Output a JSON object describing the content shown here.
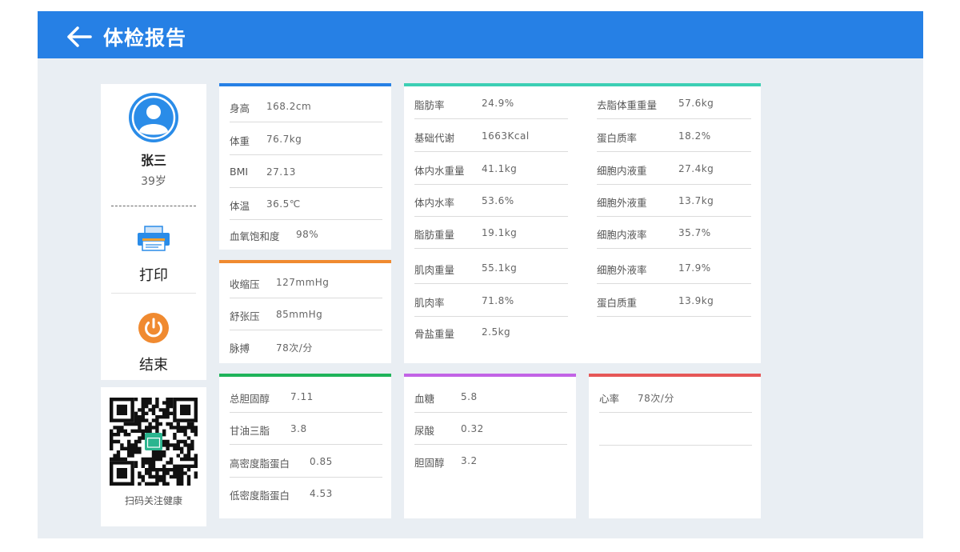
{
  "header": {
    "title": "体检报告"
  },
  "profile": {
    "name": "张三",
    "age": "39岁",
    "print_label": "打印",
    "end_label": "结束",
    "qr_caption": "扫码关注健康"
  },
  "basic": {
    "color": "#2680e5",
    "rows": [
      {
        "label": "身高",
        "value": "168.2cm"
      },
      {
        "label": "体重",
        "value": "76.7kg"
      },
      {
        "label": "BMI",
        "value": "27.13"
      },
      {
        "label": "体温",
        "value": "36.5℃"
      },
      {
        "label": "血氧饱和度",
        "value": "98%"
      }
    ]
  },
  "blood_pressure": {
    "color": "#f08a30",
    "rows": [
      {
        "label": "收缩压",
        "value": "127mmHg"
      },
      {
        "label": "舒张压",
        "value": "85mmHg"
      },
      {
        "label": "脉搏",
        "value": "78次/分"
      }
    ]
  },
  "body_composition": {
    "color": "#3ccfb4",
    "left": [
      {
        "label": "脂肪率",
        "value": "24.9%"
      },
      {
        "label": "基础代谢",
        "value": "1663Kcal"
      },
      {
        "label": "体内水重量",
        "value": "41.1kg"
      },
      {
        "label": "体内水率",
        "value": "53.6%"
      },
      {
        "label": "脂肪重量",
        "value": "19.1kg"
      },
      {
        "label": "肌肉重量",
        "value": "55.1kg"
      },
      {
        "label": "肌肉率",
        "value": "71.8%"
      },
      {
        "label": "骨盐重量",
        "value": "2.5kg"
      }
    ],
    "right": [
      {
        "label": "去脂体重重量",
        "value": "57.6kg"
      },
      {
        "label": "蛋白质率",
        "value": "18.2%"
      },
      {
        "label": "细胞内液重",
        "value": "27.4kg"
      },
      {
        "label": "细胞外液重",
        "value": "13.7kg"
      },
      {
        "label": "细胞内液率",
        "value": "35.7%"
      },
      {
        "label": "细胞外液率",
        "value": "17.9%"
      },
      {
        "label": "蛋白质重",
        "value": "13.9kg"
      }
    ]
  },
  "lipids": {
    "color": "#1fb35a",
    "rows": [
      {
        "label": "总胆固醇",
        "value": "7.11"
      },
      {
        "label": "甘油三脂",
        "value": "3.8"
      },
      {
        "label": "高密度脂蛋白",
        "value": "0.85"
      },
      {
        "label": "低密度脂蛋白",
        "value": "4.53"
      }
    ]
  },
  "glucose": {
    "color": "#c263e6",
    "rows": [
      {
        "label": "血糖",
        "value": "5.8"
      },
      {
        "label": "尿酸",
        "value": "0.32"
      },
      {
        "label": "胆固醇",
        "value": "3.2"
      }
    ]
  },
  "heart": {
    "color": "#e65757",
    "rows": [
      {
        "label": "心率",
        "value": "78次/分"
      },
      {
        "label": "",
        "value": ""
      }
    ]
  }
}
